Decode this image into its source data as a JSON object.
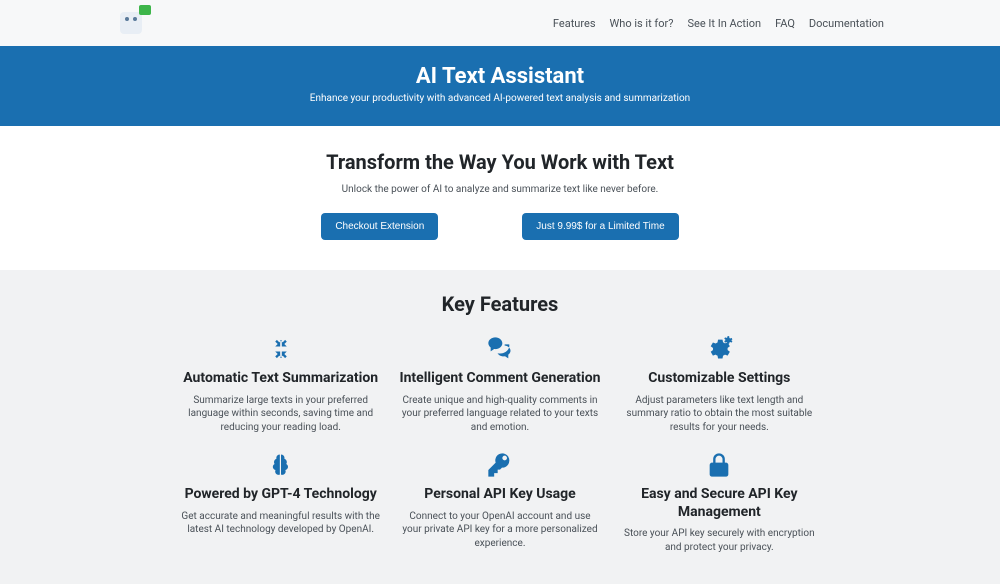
{
  "nav": {
    "items": [
      "Features",
      "Who is it for?",
      "See It In Action",
      "FAQ",
      "Documentation"
    ]
  },
  "hero": {
    "title": "AI Text Assistant",
    "subtitle": "Enhance your productivity with advanced AI-powered text analysis and summarization"
  },
  "transform": {
    "title": "Transform the Way You Work with Text",
    "text": "Unlock the power of AI to analyze and summarize text like never before.",
    "btn1": "Checkout Extension",
    "btn2": "Just 9.99$ for a Limited Time"
  },
  "features": {
    "title": "Key Features",
    "items": [
      {
        "title": "Automatic Text Summarization",
        "desc": "Summarize large texts in your preferred language within seconds, saving time and reducing your reading load."
      },
      {
        "title": "Intelligent Comment Generation",
        "desc": "Create unique and high-quality comments in your preferred language related to your texts and emotion."
      },
      {
        "title": "Customizable Settings",
        "desc": "Adjust parameters like text length and summary ratio to obtain the most suitable results for your needs."
      },
      {
        "title": "Powered by GPT-4 Technology",
        "desc": "Get accurate and meaningful results with the latest AI technology developed by OpenAI."
      },
      {
        "title": "Personal API Key Usage",
        "desc": "Connect to your OpenAI account and use your private API key for a more personalized experience."
      },
      {
        "title": "Easy and Secure API Key Management",
        "desc": "Store your API key securely with encryption and protect your privacy."
      }
    ]
  }
}
